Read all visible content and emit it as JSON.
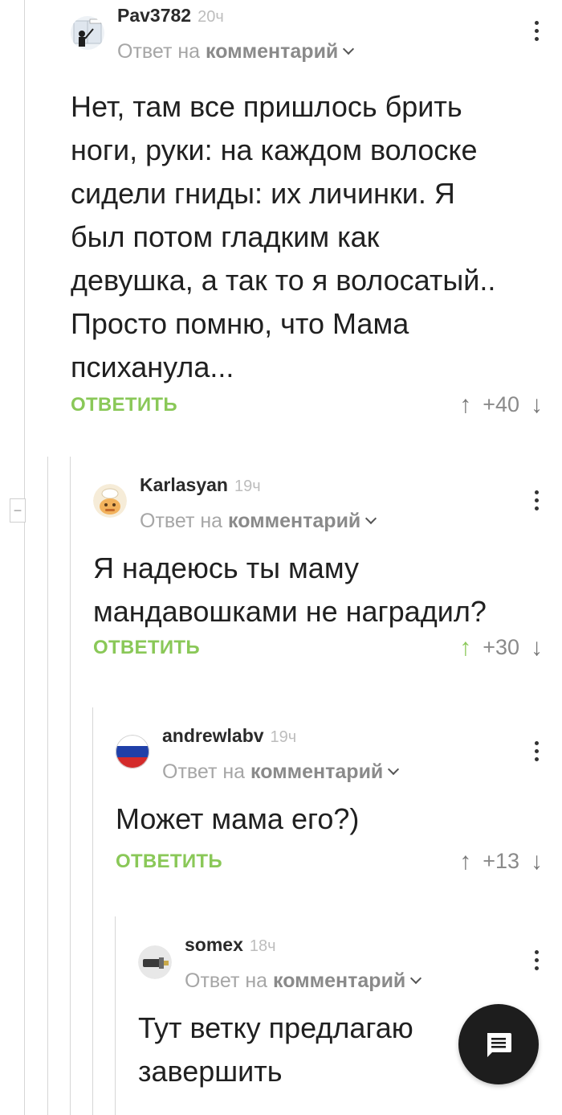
{
  "comments": [
    {
      "username": "Pav3782",
      "time": "20ч",
      "reply_prefix": "Ответ на",
      "reply_link": "комментарий",
      "text": "Нет, там все пришлось брить ноги, руки: на каждом волоске сидели гниды: их личинки. Я был потом гладким как девушка, а так то я волосатый.. Просто помню, что Мама психанула...",
      "reply_label": "ОТВЕТИТЬ",
      "rating": "+40",
      "avatar_icon": "window-cleaner-avatar"
    },
    {
      "username": "Karlasyan",
      "time": "19ч",
      "reply_prefix": "Ответ на",
      "reply_link": "комментарий",
      "text": "Я надеюсь ты маму мандавошками не наградил?",
      "reply_label": "ОТВЕТИТЬ",
      "rating": "+30",
      "upvoted": true,
      "avatar_icon": "cartoon-chef-avatar"
    },
    {
      "username": "andrewlabv",
      "time": "19ч",
      "reply_prefix": "Ответ на",
      "reply_link": "комментарий",
      "text": "Может мама его?)",
      "reply_label": "ОТВЕТИТЬ",
      "rating": "+13",
      "avatar_icon": "russian-flag-avatar"
    },
    {
      "username": "somex",
      "time": "18ч",
      "reply_prefix": "Ответ на",
      "reply_link": "комментарий",
      "text": "Тут ветку предлагаю завершить",
      "avatar_icon": "connector-avatar"
    }
  ],
  "colors": {
    "accent_green": "#8ac858",
    "fab_background": "#1d1d1d"
  },
  "icons": {
    "collapse": "minus-icon",
    "fab": "comment-icon",
    "menu": "more-vertical-icon",
    "upvote": "arrow-up-icon",
    "downvote": "arrow-down-icon"
  }
}
